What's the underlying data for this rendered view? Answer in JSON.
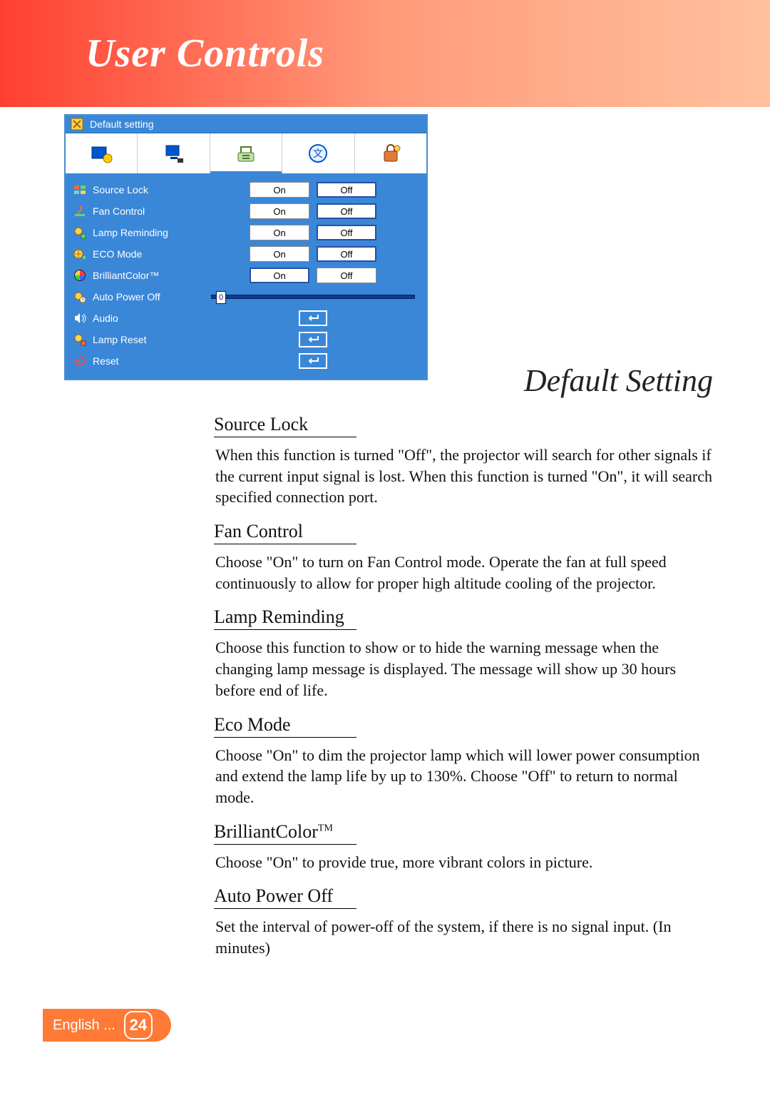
{
  "header": {
    "title": "User Controls"
  },
  "section_title": "Default Setting",
  "menu": {
    "title": "Default setting",
    "tabs": [
      {
        "name": "image-tab"
      },
      {
        "name": "display-tab"
      },
      {
        "name": "settings-tab"
      },
      {
        "name": "language-tab"
      },
      {
        "name": "lock-tab"
      }
    ],
    "rows": [
      {
        "label": "Source Lock",
        "type": "toggle",
        "on": "On",
        "off": "Off",
        "value": "Off"
      },
      {
        "label": "Fan Control",
        "type": "toggle",
        "on": "On",
        "off": "Off",
        "value": "Off"
      },
      {
        "label": "Lamp Reminding",
        "type": "toggle",
        "on": "On",
        "off": "Off",
        "value": "Off"
      },
      {
        "label": "ECO Mode",
        "type": "toggle",
        "on": "On",
        "off": "Off",
        "value": "Off"
      },
      {
        "label": "BrilliantColor™",
        "type": "toggle",
        "on": "On",
        "off": "Off",
        "value": "On"
      },
      {
        "label": "Auto Power Off",
        "type": "slider",
        "value": "0"
      },
      {
        "label": "Audio",
        "type": "enter"
      },
      {
        "label": "Lamp Reset",
        "type": "enter"
      },
      {
        "label": "Reset",
        "type": "enter"
      }
    ]
  },
  "content": {
    "items": [
      {
        "heading": "Source Lock",
        "text": "When this function is turned \"Off\", the projector will search for other signals if the current input signal is lost. When this function is turned \"On\", it will search specified connection port."
      },
      {
        "heading": "Fan Control",
        "text": "Choose \"On\" to turn on Fan Control mode. Operate the fan at full speed continuously to allow for proper high altitude cooling of the projector."
      },
      {
        "heading": "Lamp Reminding",
        "text": "Choose this function to show or to hide the warning message when the changing lamp message is displayed. The message will show up 30 hours before end of life."
      },
      {
        "heading": "Eco Mode",
        "text": "Choose \"On\" to dim the projector lamp which will lower power consumption and extend the lamp life by up to 130%. Choose \"Off\" to return to normal mode."
      },
      {
        "heading": "BrilliantColor",
        "heading_suffix": "TM",
        "text": "Choose \"On\" to provide true, more vibrant colors in picture."
      },
      {
        "heading": "Auto Power Off",
        "text": "Set the interval of power-off of the system, if there is no signal input. (In minutes)"
      }
    ]
  },
  "footer": {
    "language": "English ...",
    "page": "24"
  }
}
